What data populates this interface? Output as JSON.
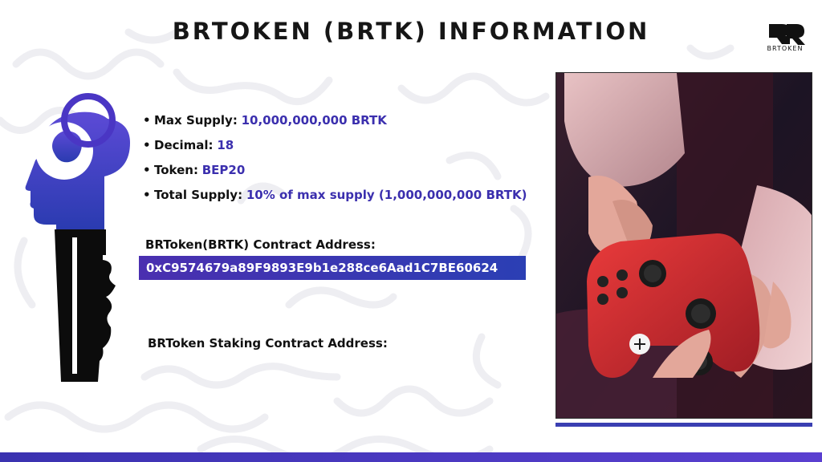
{
  "title": "BRTOKEN (BRTK) INFORMATION",
  "logo": {
    "mark": "bR",
    "caption": "BRTOKEN",
    "icon": "brtoken-logo"
  },
  "specs": [
    {
      "label": "Max Supply:",
      "value": "10,000,000,000 BRTK"
    },
    {
      "label": "Decimal:",
      "value": "18"
    },
    {
      "label": "Token:",
      "value": "BEP20"
    },
    {
      "label": "Total Supply:",
      "value": "10% of max supply (1,000,000,000 BRTK)"
    }
  ],
  "contract": {
    "label": "BRToken(BRTK) Contract Address:",
    "address": "0xC9574679a89F9893E9b1e288ce6Aad1C7BE60624"
  },
  "staking": {
    "label": "BRToken Staking Contract Address:"
  },
  "illustration": {
    "icon": "head-key-icon"
  },
  "photo": {
    "icon": "gamepad-photo"
  },
  "colors": {
    "accent": "#3b2fae",
    "address_bg": "#4a2fb0",
    "bar": "#3a32b0",
    "key_gradient_top": "#5c4ad6",
    "key_gradient_bottom": "#2a3bb0"
  }
}
